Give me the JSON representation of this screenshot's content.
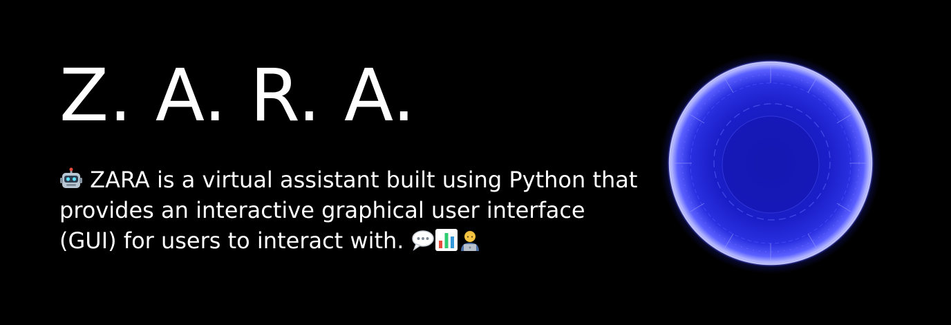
{
  "banner": {
    "title": "Z. A. R. A.",
    "description_first_line": "ZARA is a virtual assistant built using",
    "description_rest": "Python that provides an interactive graphical user interface (GUI) for users to interact with.",
    "icons": {
      "lead": "robot-icon",
      "trailing": [
        "speech-bubble-icon",
        "bar-chart-icon",
        "technologist-icon"
      ]
    },
    "orb_colors": {
      "rim": "#6f74ff",
      "core": "#1a1ec8",
      "glow": "#2a2fff"
    }
  }
}
